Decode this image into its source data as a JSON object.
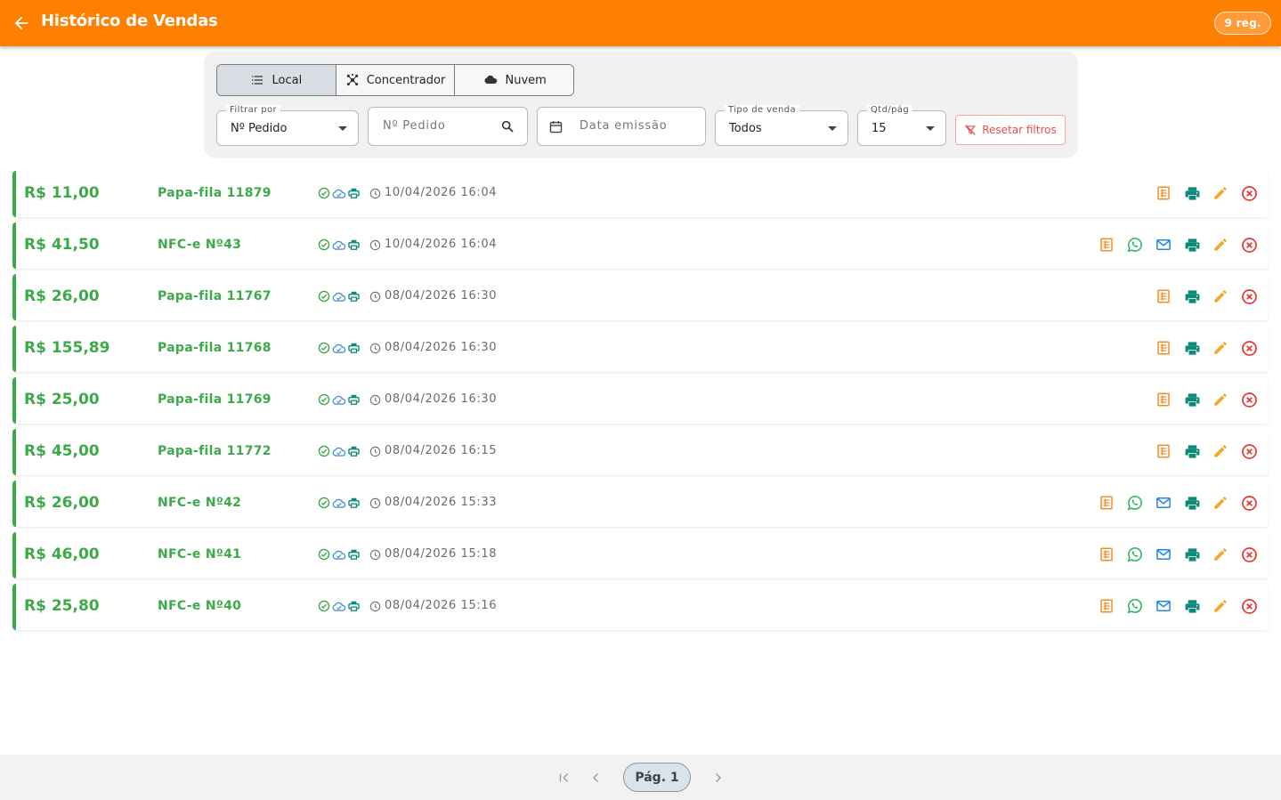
{
  "appbar": {
    "title": "Histórico de Vendas",
    "badge": "9 reg.",
    "color": "#FF7F00"
  },
  "source_tabs": [
    {
      "label": "Local",
      "icon": "list-icon",
      "active": true
    },
    {
      "label": "Concentrador",
      "icon": "hub-icon",
      "active": false
    },
    {
      "label": "Nuvem",
      "icon": "cloud-icon",
      "active": false
    }
  ],
  "filters": {
    "filter_by": {
      "legend": "Filtrar por",
      "value": "Nº Pedido"
    },
    "order_search": {
      "placeholder": "Nº Pedido"
    },
    "date": {
      "placeholder": "Data emissão"
    },
    "sale_type": {
      "legend": "Tipo de venda",
      "value": "Todos"
    },
    "per_page": {
      "legend": "Qtd/pág",
      "value": "15"
    },
    "reset_label": "Resetar filtros"
  },
  "sales": [
    {
      "amount": "R$ 11,00",
      "order": "Papa-fila 11879",
      "date": "10/04/2026 16:04",
      "nfce": false
    },
    {
      "amount": "R$ 41,50",
      "order": "NFC-e Nº43",
      "date": "10/04/2026 16:04",
      "nfce": true
    },
    {
      "amount": "R$ 26,00",
      "order": "Papa-fila 11767",
      "date": "08/04/2026 16:30",
      "nfce": false
    },
    {
      "amount": "R$ 155,89",
      "order": "Papa-fila 11768",
      "date": "08/04/2026 16:30",
      "nfce": false
    },
    {
      "amount": "R$ 25,00",
      "order": "Papa-fila 11769",
      "date": "08/04/2026 16:30",
      "nfce": false
    },
    {
      "amount": "R$ 45,00",
      "order": "Papa-fila 11772",
      "date": "08/04/2026 16:15",
      "nfce": false
    },
    {
      "amount": "R$ 26,00",
      "order": "NFC-e Nº42",
      "date": "08/04/2026 15:33",
      "nfce": true
    },
    {
      "amount": "R$ 46,00",
      "order": "NFC-e Nº41",
      "date": "08/04/2026 15:18",
      "nfce": true
    },
    {
      "amount": "R$ 25,80",
      "order": "NFC-e Nº40",
      "date": "08/04/2026 15:16",
      "nfce": true
    }
  ],
  "colors": {
    "paid_green": "#3daa4a",
    "details_orange": "#F28C28",
    "whatsapp_green": "#25B35A",
    "email_blue": "#1E88E5",
    "print_teal": "#0E8A7A",
    "edit_amber": "#F5A623",
    "cancel_red": "#E53935"
  },
  "pagination": {
    "label": "Pág. 1"
  }
}
